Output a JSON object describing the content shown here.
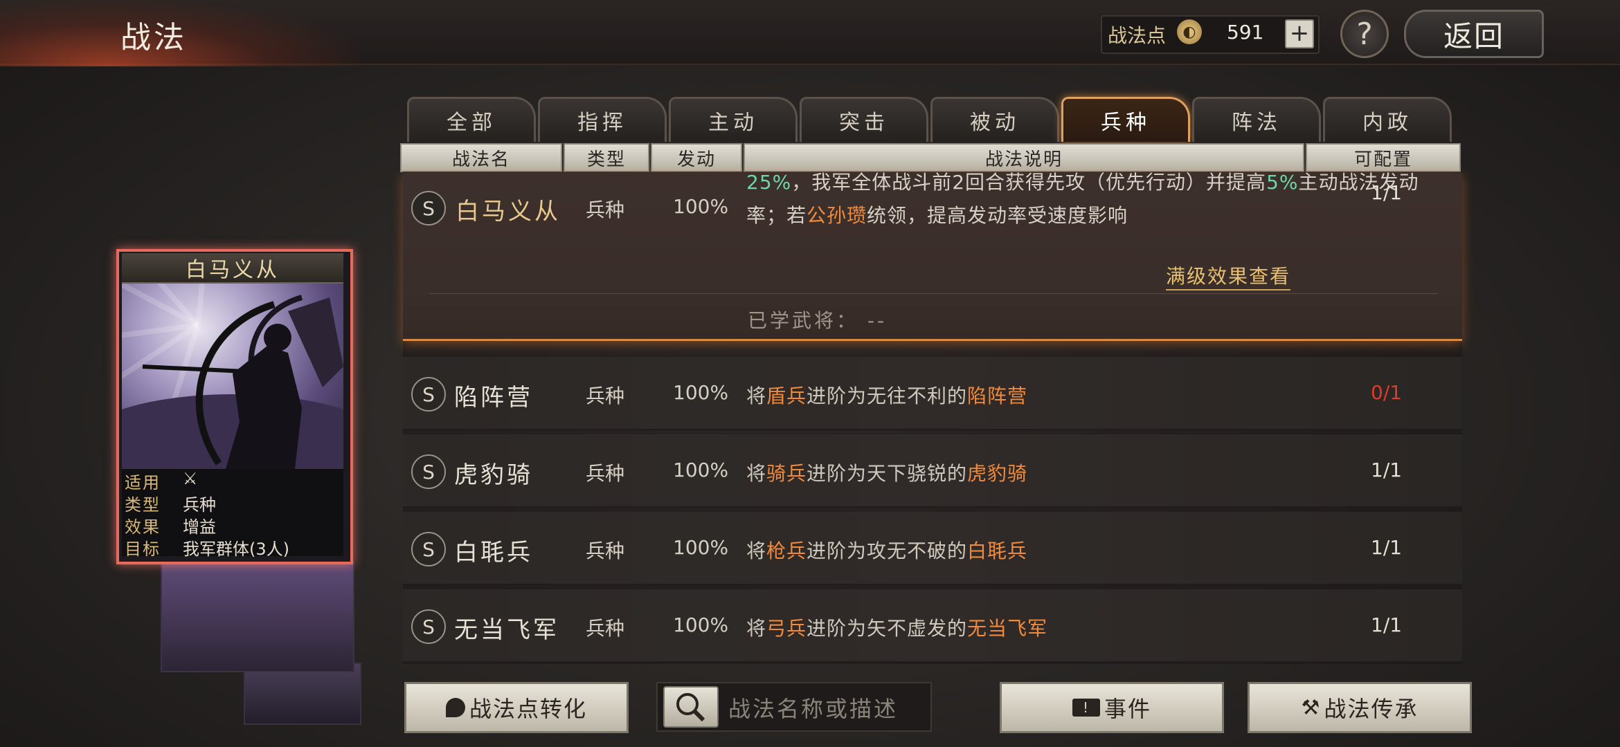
{
  "header": {
    "title": "战法",
    "points_label": "战法点",
    "points_value": "591",
    "plus_glyph": "+",
    "help_glyph": "?",
    "back_label": "返回"
  },
  "tabs": [
    "全部",
    "指挥",
    "主动",
    "突击",
    "被动",
    "兵种",
    "阵法",
    "内政"
  ],
  "active_tab": "兵种",
  "columns": [
    "战法名",
    "类型",
    "发动",
    "战法说明",
    "可配置"
  ],
  "expanded": {
    "badge": "S",
    "name": "白马义从",
    "type": "兵种",
    "rate": "100%",
    "desc_parts": [
      "25%",
      "，我军全体战斗前2回合获得先攻（优先行动）并提高",
      "5%",
      "主动战法发动率；若",
      "公孙瓒",
      "统领，提高发动率受速度影响"
    ],
    "config": "1/1",
    "view_full": "满级效果查看",
    "learned_label": "已学武将：",
    "learned_value": "--"
  },
  "rows": [
    {
      "badge": "S",
      "name": "陷阵营",
      "type": "兵种",
      "rate": "100%",
      "d1": "将",
      "d2": "盾兵",
      "d3": "进阶为无往不利的",
      "d4": "陷阵营",
      "config": "0/1"
    },
    {
      "badge": "S",
      "name": "虎豹骑",
      "type": "兵种",
      "rate": "100%",
      "d1": "将",
      "d2": "骑兵",
      "d3": "进阶为天下骁锐的",
      "d4": "虎豹骑",
      "config": "1/1"
    },
    {
      "badge": "S",
      "name": "白毦兵",
      "type": "兵种",
      "rate": "100%",
      "d1": "将",
      "d2": "枪兵",
      "d3": "进阶为攻无不破的",
      "d4": "白毦兵",
      "config": "1/1"
    },
    {
      "badge": "S",
      "name": "无当飞军",
      "type": "兵种",
      "rate": "100%",
      "d1": "将",
      "d2": "弓兵",
      "d3": "进阶为矢不虚发的",
      "d4": "无当飞军",
      "config": "1/1"
    }
  ],
  "card": {
    "title": "白马义从",
    "info": [
      {
        "key": "适用",
        "value": "⚔"
      },
      {
        "key": "类型",
        "value": "兵种"
      },
      {
        "key": "效果",
        "value": "增益"
      },
      {
        "key": "目标",
        "value": "我军群体(3人)"
      }
    ]
  },
  "bottom": {
    "convert_label": "战法点转化",
    "search_placeholder": "战法名称或描述",
    "events_label": "事件",
    "inherit_label": "战法传承"
  },
  "colors": {
    "highlight": "#f08a3c",
    "active_tab_border": "#e0a060",
    "config_zero": "#e03a2a"
  },
  "icons": [
    "points-coin-icon",
    "plus-icon",
    "help-icon",
    "back-arrow-icon",
    "search-icon",
    "fire-icon",
    "event-icon",
    "hammer-icon"
  ]
}
